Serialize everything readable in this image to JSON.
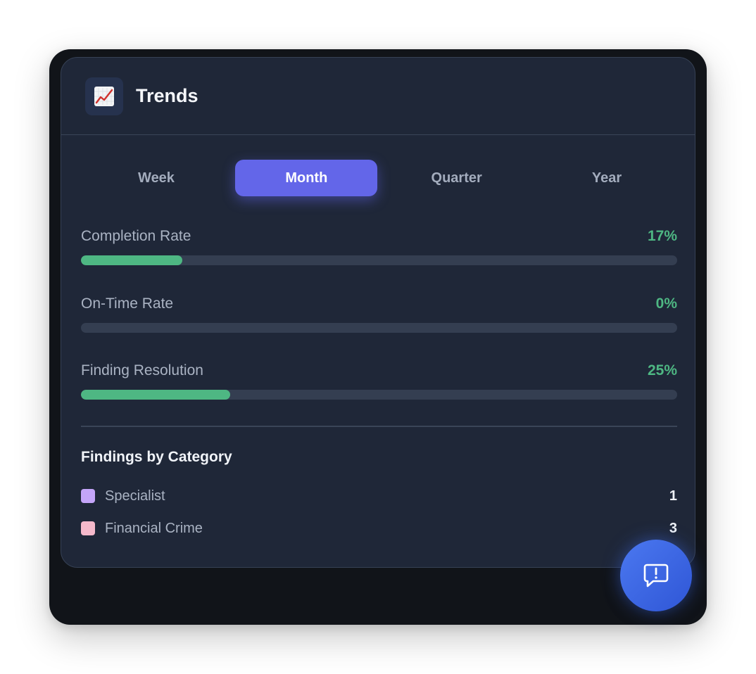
{
  "card": {
    "title": "Trends",
    "icon": "chart-increasing-icon"
  },
  "tabs": [
    {
      "label": "Week",
      "active": false
    },
    {
      "label": "Month",
      "active": true
    },
    {
      "label": "Quarter",
      "active": false
    },
    {
      "label": "Year",
      "active": false
    }
  ],
  "metrics": [
    {
      "label": "Completion Rate",
      "value": "17%",
      "fraction": 0.17
    },
    {
      "label": "On-Time Rate",
      "value": "0%",
      "fraction": 0.0
    },
    {
      "label": "Finding Resolution",
      "value": "25%",
      "fraction": 0.25
    }
  ],
  "findings": {
    "title": "Findings by Category",
    "categories": [
      {
        "label": "Specialist",
        "count": "1",
        "color": "#c4a5f9"
      },
      {
        "label": "Financial Crime",
        "count": "3",
        "color": "#f5b9cb"
      }
    ]
  },
  "fab": {
    "icon": "feedback-icon"
  },
  "colors": {
    "accent": "#6366e9",
    "success": "#4eb783",
    "card_bg": "#1f2738",
    "frame_bg": "#111419"
  }
}
